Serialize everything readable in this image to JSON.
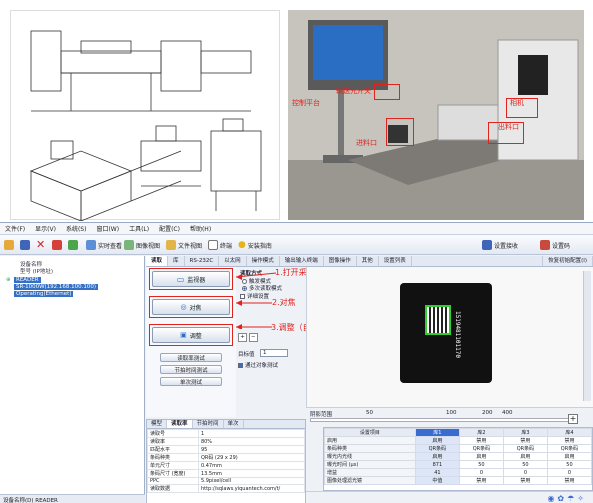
{
  "photo": {
    "labels": {
      "control_platform": "控制平台",
      "sensor_switch": "输送光开关",
      "infeed": "进料口",
      "outfeed": "出料口",
      "camera": "相机"
    }
  },
  "menubar": {
    "items": [
      "文件(F)",
      "显示(V)",
      "系统(S)",
      "窗口(W)",
      "工具(L)",
      "配置(C)",
      "帮助(H)"
    ]
  },
  "toolbar": {
    "realtime_view": "实时查看",
    "image_view": "图像视图",
    "file_view": "文件视图",
    "terminal": "终端",
    "install_guide": "安装指南",
    "device_settings": "设置接收",
    "settings_short": "设置码"
  },
  "tree": {
    "header_device": "设备名称",
    "header_model": "型号 (IP地址)",
    "device_name": "READER",
    "device_addr": "SR-1000W(192.168.100.100)",
    "device_state": "Operating(Ethernet)",
    "status": "设备名称(D)  READER"
  },
  "tabs": [
    "读取",
    "库",
    "RS-232C",
    "以太网",
    "操作模式",
    "输出输入终端",
    "图像操作",
    "其他",
    "设置列表"
  ],
  "tab_right": "恢复初始配置(I)",
  "ops": {
    "monitor": "监视器",
    "focus": "对焦",
    "adjust": "调整",
    "read_rate_test": "读取率测试",
    "tact_time_test": "节拍时间测试",
    "single_test": "单次测试"
  },
  "settings": {
    "read_mode_title": "读取方式",
    "mode_single": "触发模式",
    "mode_multi": "多次读取模式",
    "detail_settings": "详细设置",
    "target_value": "目标值",
    "target_input": "1",
    "multi_read_test": "通过对象测试"
  },
  "annotations": {
    "step1": "1.打开采集播放模式",
    "step2": "2.对焦",
    "step3": "3.调整（自动调整为最佳参数）"
  },
  "preview": {
    "code_text": "1519481101170",
    "hist_label": "阴影范围",
    "hist_ticks": [
      "50",
      "100",
      "200",
      "400"
    ]
  },
  "info": {
    "tabs": [
      "模型",
      "读取率",
      "节拍时间",
      "单次"
    ],
    "rows": [
      [
        "读取号",
        "1"
      ],
      [
        "读取率",
        "80%"
      ],
      [
        "匹配水平",
        "95"
      ],
      [
        "条码种类",
        "QR码 (29 x 29)"
      ],
      [
        "单元尺寸",
        "0.47mm"
      ],
      [
        "条码尺寸 (宽度)",
        "13.5mm"
      ],
      [
        "PPC",
        "5.9pixel/cell"
      ],
      [
        "读取数据",
        "http://sqlaws.yiquantech.com/t/"
      ]
    ]
  },
  "config": {
    "headers": [
      "设置项目",
      "库1",
      "库2",
      "库3",
      "库4"
    ],
    "rows": [
      [
        "启用",
        "启用",
        "禁用",
        "禁用",
        "禁用"
      ],
      [
        "条码种类",
        "QR条码",
        "QR条码",
        "QR条码",
        "QR条码"
      ],
      [
        "曝光内光线",
        "启用",
        "启用",
        "启用",
        "启用"
      ],
      [
        "曝光时间 (μs)",
        "871",
        "50",
        "50",
        "50"
      ],
      [
        "增益",
        "41",
        "0",
        "0",
        "0"
      ],
      [
        "图像处理滤光镜",
        "中值",
        "禁用",
        "禁用",
        "禁用"
      ]
    ]
  }
}
